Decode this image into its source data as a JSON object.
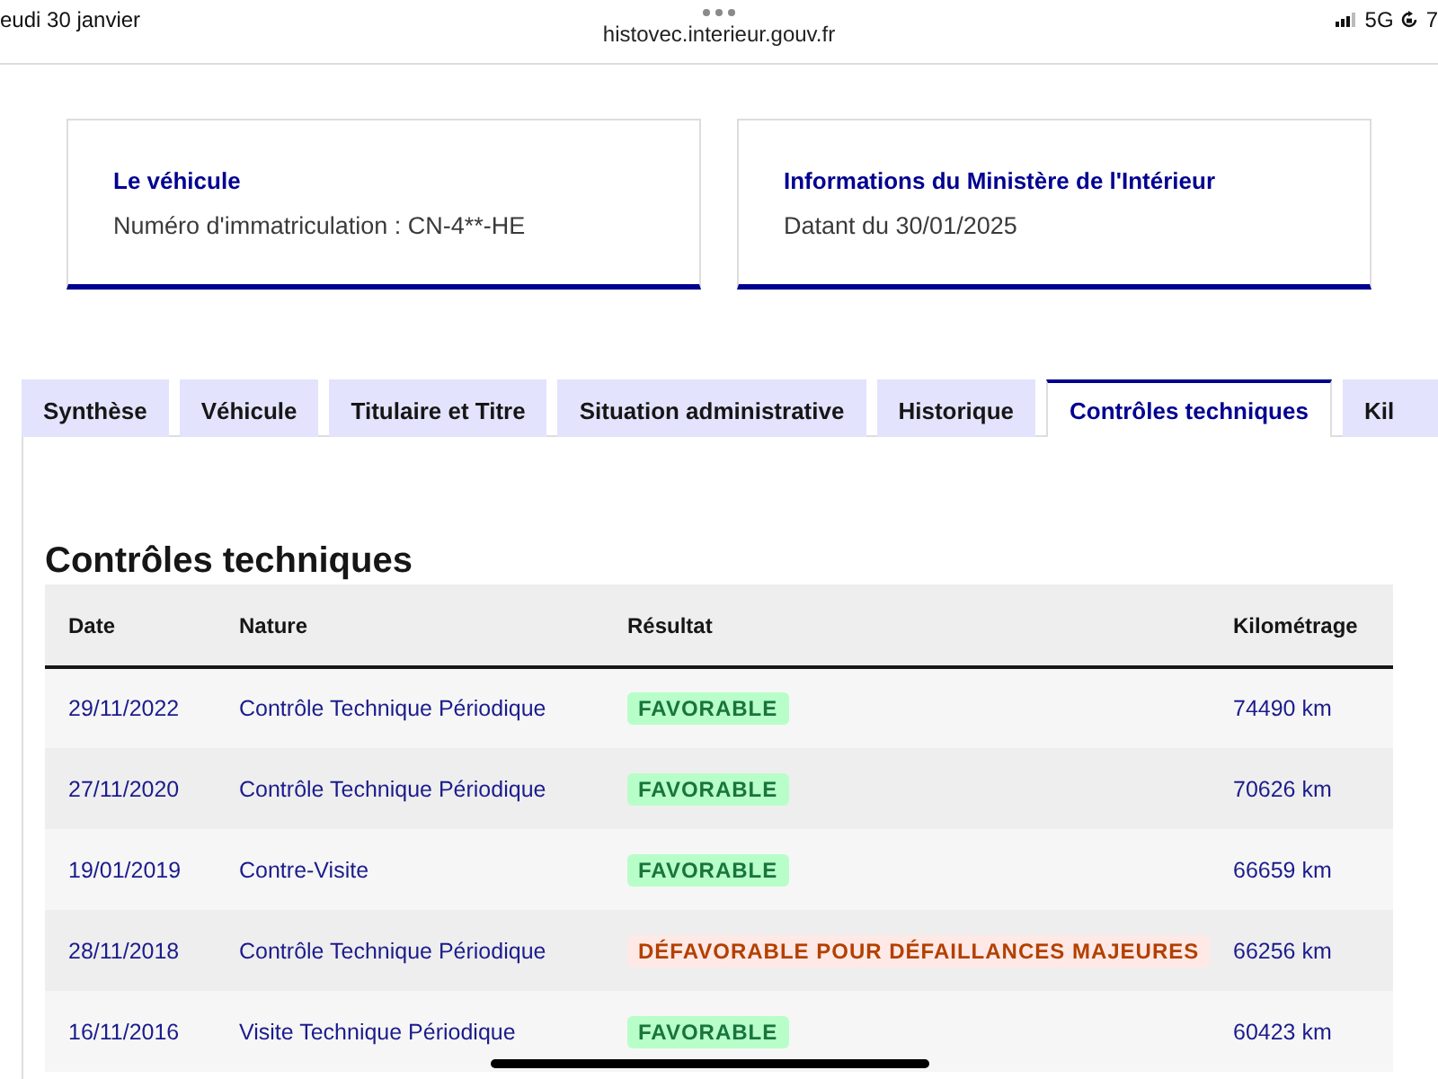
{
  "status_bar": {
    "date": "eudi 30 janvier",
    "network": "5G",
    "trailing_text": "7"
  },
  "address_bar": {
    "url": "histovec.interieur.gouv.fr"
  },
  "cards": [
    {
      "title": "Le véhicule",
      "text": "Numéro d'immatriculation : CN-4**-HE"
    },
    {
      "title": "Informations du Ministère de l'Intérieur",
      "text": "Datant du 30/01/2025"
    }
  ],
  "tabs": [
    {
      "label": "Synthèse",
      "selected": false
    },
    {
      "label": "Véhicule",
      "selected": false
    },
    {
      "label": "Titulaire et Titre",
      "selected": false
    },
    {
      "label": "Situation administrative",
      "selected": false
    },
    {
      "label": "Historique",
      "selected": false
    },
    {
      "label": "Contrôles techniques",
      "selected": true
    },
    {
      "label": "Kil",
      "selected": false
    }
  ],
  "section": {
    "title": "Contrôles techniques"
  },
  "table": {
    "columns": [
      "Date",
      "Nature",
      "Résultat",
      "Kilométrage"
    ],
    "rows": [
      {
        "date": "29/11/2022",
        "nature": "Contrôle Technique Périodique",
        "result": {
          "label": "FAVORABLE",
          "kind": "favorable"
        },
        "mileage": "74490 km"
      },
      {
        "date": "27/11/2020",
        "nature": "Contrôle Technique Périodique",
        "result": {
          "label": "FAVORABLE",
          "kind": "favorable"
        },
        "mileage": "70626 km"
      },
      {
        "date": "19/01/2019",
        "nature": "Contre-Visite",
        "result": {
          "label": "FAVORABLE",
          "kind": "favorable"
        },
        "mileage": "66659 km"
      },
      {
        "date": "28/11/2018",
        "nature": "Contrôle Technique Périodique",
        "result": {
          "label": "DÉFAVORABLE POUR DÉFAILLANCES MAJEURES",
          "kind": "unfavorable"
        },
        "mileage": "66256 km"
      },
      {
        "date": "16/11/2016",
        "nature": "Visite Technique Périodique",
        "result": {
          "label": "FAVORABLE",
          "kind": "favorable"
        },
        "mileage": "60423 km"
      }
    ]
  }
}
